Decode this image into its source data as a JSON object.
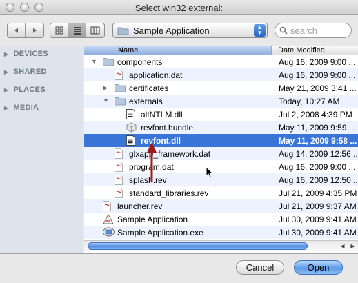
{
  "window": {
    "title": "Select win32 external:"
  },
  "toolbar": {
    "back_icon": "back-arrow-icon",
    "forward_icon": "forward-arrow-icon",
    "view_modes": [
      "icon-view",
      "list-view",
      "column-view"
    ],
    "active_view": "list-view",
    "location": "Sample Application",
    "search_placeholder": "search"
  },
  "sidebar": {
    "sections": [
      {
        "label": "DEVICES"
      },
      {
        "label": "SHARED"
      },
      {
        "label": "PLACES"
      },
      {
        "label": "MEDIA"
      }
    ]
  },
  "columns": {
    "name": "Name",
    "date": "Date Modified"
  },
  "files": [
    {
      "name": "components",
      "date": "Aug 16, 2009 9:00 ...",
      "icon": "folder-icon",
      "disclosure": "expanded",
      "depth": 0
    },
    {
      "name": "application.dat",
      "date": "Aug 16, 2009 9:00 ...",
      "icon": "document-icon",
      "disclosure": "none",
      "depth": 1
    },
    {
      "name": "certificates",
      "date": "May 21, 2009 3:41 ...",
      "icon": "folder-icon",
      "disclosure": "collapsed",
      "depth": 1
    },
    {
      "name": "externals",
      "date": "Today, 10:27 AM",
      "icon": "folder-icon",
      "disclosure": "expanded",
      "depth": 1
    },
    {
      "name": "altNTLM.dll",
      "date": "Jul 2, 2008 4:39 PM",
      "icon": "dll-icon",
      "disclosure": "none",
      "depth": 2
    },
    {
      "name": "revfont.bundle",
      "date": "May 11, 2009 9:59 ...",
      "icon": "bundle-icon",
      "disclosure": "none",
      "depth": 2
    },
    {
      "name": "revfont.dll",
      "date": "May 11, 2009 9:58 ...",
      "icon": "dll-icon",
      "disclosure": "none",
      "depth": 2,
      "selected": true
    },
    {
      "name": "glxapp_framework.dat",
      "date": "Aug 14, 2009 12:56 ...",
      "icon": "document-icon",
      "disclosure": "none",
      "depth": 1
    },
    {
      "name": "program.dat",
      "date": "Aug 16, 2009 9:00 ...",
      "icon": "document-icon",
      "disclosure": "none",
      "depth": 1
    },
    {
      "name": "splash.rev",
      "date": "Aug 16, 2009 12:50 ...",
      "icon": "document-icon",
      "disclosure": "none",
      "depth": 1
    },
    {
      "name": "standard_libraries.rev",
      "date": "Jul 21, 2009 4:35 PM",
      "icon": "document-icon",
      "disclosure": "none",
      "depth": 1
    },
    {
      "name": "launcher.rev",
      "date": "Jul 21, 2009 9:37 AM",
      "icon": "document-icon",
      "disclosure": "none",
      "depth": 0
    },
    {
      "name": "Sample Application",
      "date": "Jul 30, 2009 9:41 AM",
      "icon": "app-icon",
      "disclosure": "none",
      "depth": 0
    },
    {
      "name": "Sample Application.exe",
      "date": "Jul 30, 2009 9:41 AM",
      "icon": "exe-icon",
      "disclosure": "none",
      "depth": 0
    }
  ],
  "horizontal_scroll": {
    "thumb_fraction": 0.85
  },
  "buttons": {
    "cancel": "Cancel",
    "open": "Open"
  },
  "colors": {
    "selection": "#3875d7",
    "annotation_arrow": "#9b1c1c",
    "default_button": "#5e9be8"
  }
}
